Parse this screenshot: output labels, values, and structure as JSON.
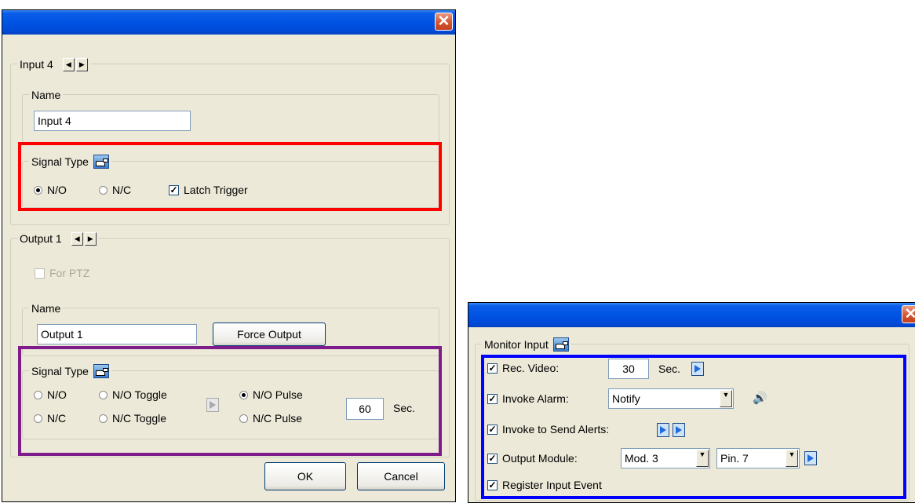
{
  "left_dialog": {
    "close_label": "✕",
    "input_section": {
      "title": "Input 4",
      "name_group_title": "Name",
      "name_value": "Input 4",
      "signal_type_title": "Signal Type",
      "radios": [
        {
          "label": "N/O",
          "selected": true
        },
        {
          "label": "N/C",
          "selected": false
        }
      ],
      "latch_trigger": {
        "label": "Latch Trigger",
        "checked": true
      }
    },
    "output_section": {
      "title": "Output 1",
      "for_ptz": {
        "label": "For PTZ",
        "checked": false,
        "enabled": false
      },
      "name_group_title": "Name",
      "name_value": "Output 1",
      "force_output_label": "Force Output",
      "signal_type_title": "Signal Type",
      "radios": [
        {
          "label": "N/O",
          "selected": false
        },
        {
          "label": "N/O Toggle",
          "selected": false
        },
        {
          "label": "N/O Pulse",
          "selected": true
        },
        {
          "label": "N/C",
          "selected": false
        },
        {
          "label": "N/C Toggle",
          "selected": false
        },
        {
          "label": "N/C Pulse",
          "selected": false
        }
      ],
      "pulse_seconds": "60",
      "seconds_unit": "Sec."
    },
    "ok_label": "OK",
    "cancel_label": "Cancel",
    "highlight_colors": {
      "input_signal": "#ff0000",
      "output_signal": "#7d1c8a"
    }
  },
  "right_dialog": {
    "close_label": "✕",
    "monitor_input_title": "Monitor Input",
    "rec_video": {
      "label": "Rec. Video:",
      "checked": true,
      "value": "30",
      "unit": "Sec."
    },
    "invoke_alarm": {
      "label": "Invoke Alarm:",
      "checked": true,
      "value": "Notify"
    },
    "invoke_alerts": {
      "label": "Invoke to Send Alerts:",
      "checked": true
    },
    "output_module": {
      "label": "Output Module:",
      "checked": true,
      "module": "Mod. 3",
      "pin": "Pin. 7"
    },
    "register_event": {
      "label": "Register Input Event",
      "checked": true
    },
    "highlight_color": "#0000ff"
  },
  "icons": {
    "close": "close-icon",
    "arrows": [
      "arrow-left-icon",
      "arrow-right-icon"
    ],
    "hand": "hand-pointer-icon",
    "play": "play-icon",
    "speaker": "speaker-icon"
  }
}
